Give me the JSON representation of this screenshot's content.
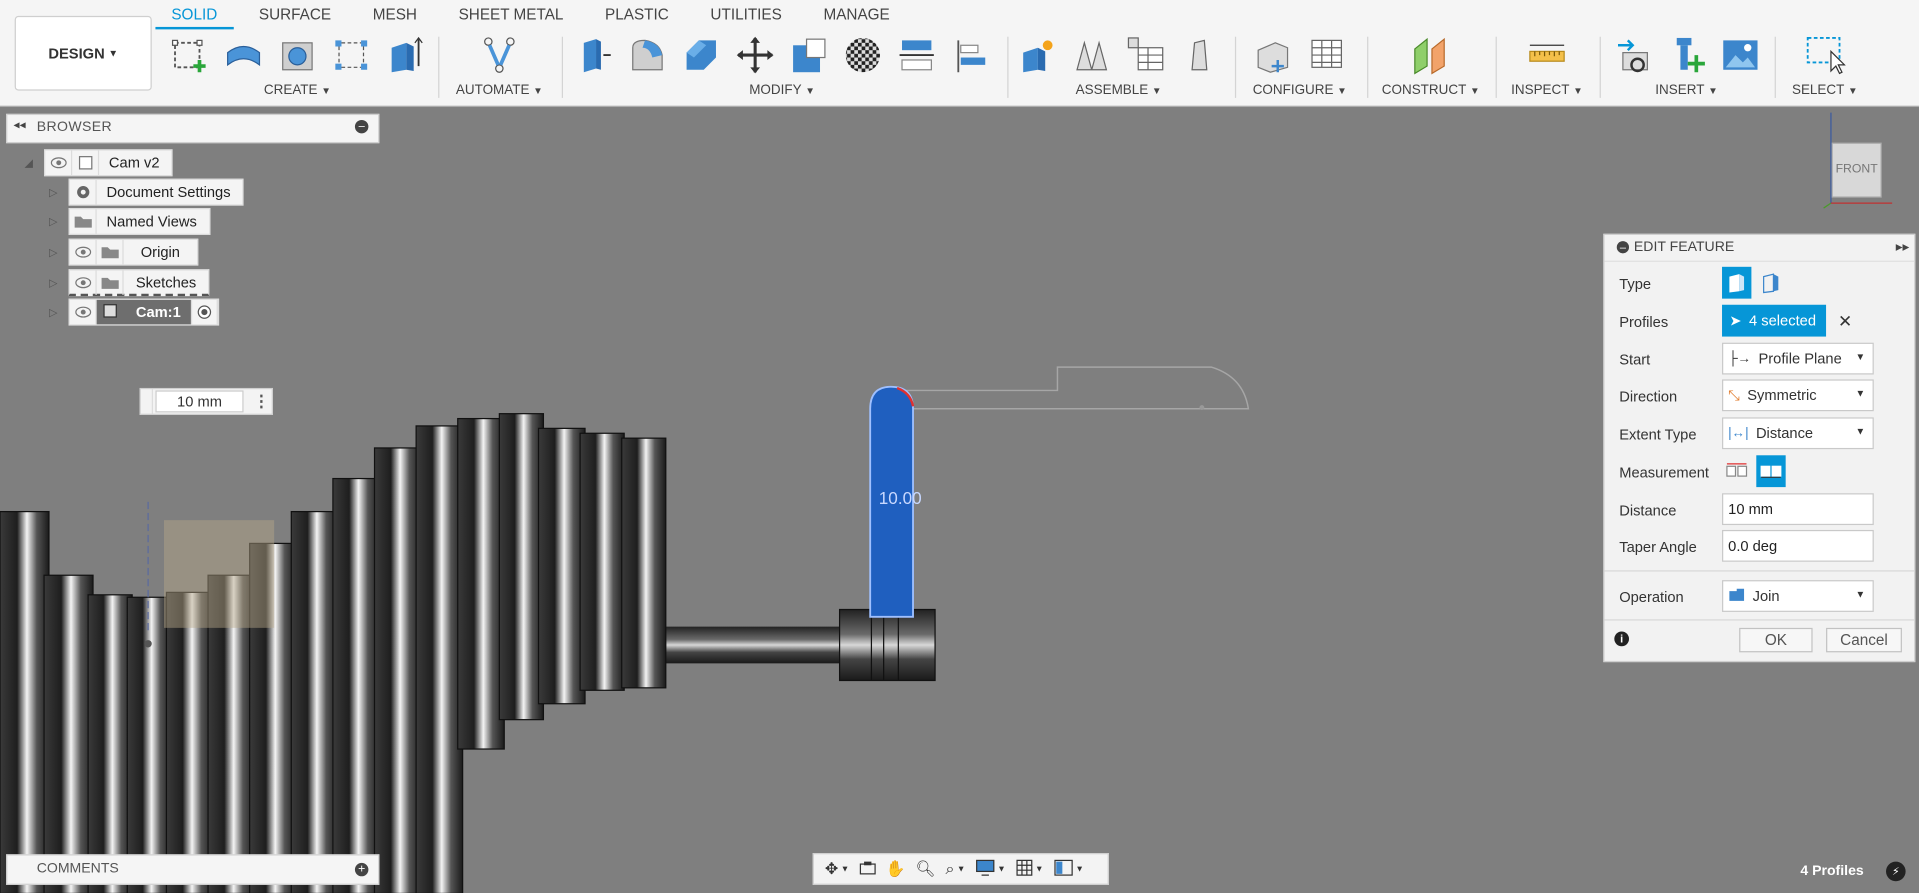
{
  "toolbar": {
    "design_label": "DESIGN",
    "tabs": [
      "SOLID",
      "SURFACE",
      "MESH",
      "SHEET METAL",
      "PLASTIC",
      "UTILITIES",
      "MANAGE"
    ],
    "groups": {
      "create": "CREATE",
      "automate": "AUTOMATE",
      "modify": "MODIFY",
      "assemble": "ASSEMBLE",
      "configure": "CONFIGURE",
      "construct": "CONSTRUCT",
      "inspect": "INSPECT",
      "insert": "INSERT",
      "select": "SELECT"
    }
  },
  "browser": {
    "title": "BROWSER",
    "items": [
      {
        "label": "Cam v2"
      },
      {
        "label": "Document Settings"
      },
      {
        "label": "Named Views"
      },
      {
        "label": "Origin"
      },
      {
        "label": "Sketches"
      },
      {
        "label": "Cam:1"
      }
    ]
  },
  "comments": {
    "title": "COMMENTS"
  },
  "viewport": {
    "distance_input_value": "10 mm",
    "dimension_label": "10.00",
    "viewcube_face": "FRONT",
    "viewcube_axis": "Z"
  },
  "edit_feature": {
    "title": "EDIT FEATURE",
    "rows": {
      "type": "Type",
      "profiles": "Profiles",
      "start": "Start",
      "direction": "Direction",
      "extent_type": "Extent Type",
      "measurement": "Measurement",
      "distance": "Distance",
      "taper_angle": "Taper Angle",
      "operation": "Operation"
    },
    "values": {
      "profiles": "4 selected",
      "start": "Profile Plane",
      "direction": "Symmetric",
      "extent_type": "Distance",
      "distance": "10 mm",
      "taper_angle": "0.0 deg",
      "operation": "Join"
    },
    "ok": "OK",
    "cancel": "Cancel"
  },
  "status": {
    "profiles": "4 Profiles"
  },
  "colors": {
    "accent": "#0696d7",
    "selection": "#1f5fbf"
  }
}
